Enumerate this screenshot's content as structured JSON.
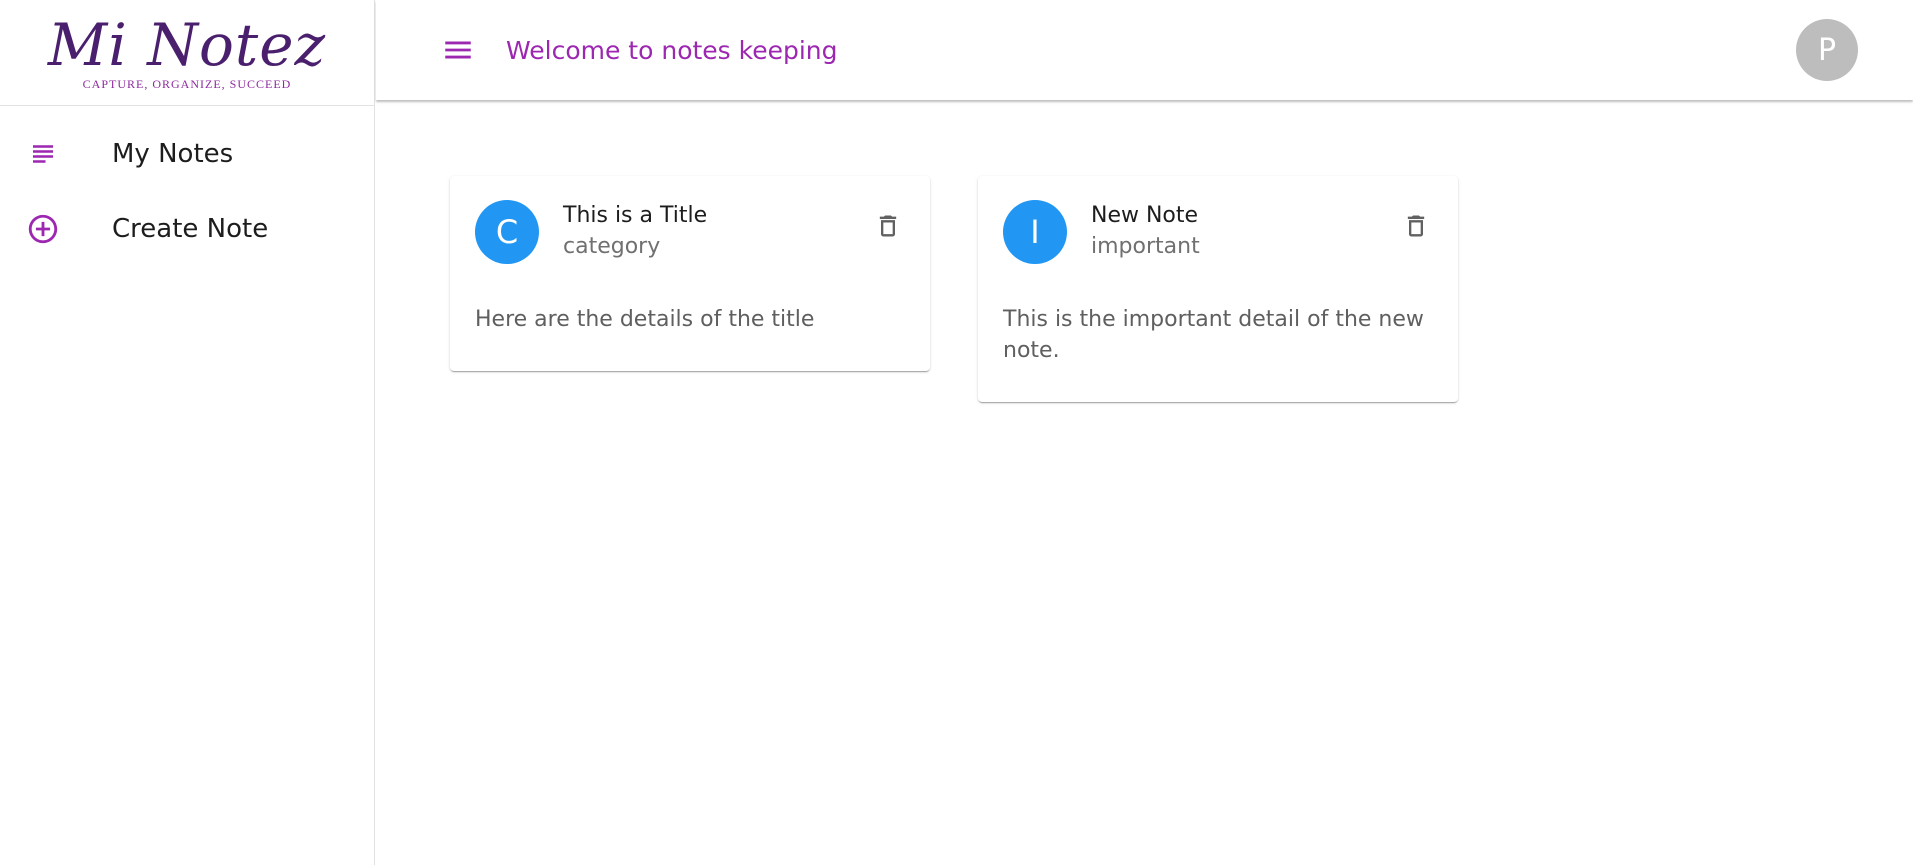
{
  "sidebar": {
    "logo": {
      "script_text": "Mi Notez",
      "tagline": "CAPTURE, ORGANIZE, SUCCEED"
    },
    "items": [
      {
        "label": "My Notes",
        "icon": "subject-icon"
      },
      {
        "label": "Create Note",
        "icon": "add-circle-icon"
      }
    ]
  },
  "header": {
    "menu_icon": "menu-icon",
    "title": "Welcome to notes keeping",
    "avatar_initial": "P"
  },
  "notes": [
    {
      "avatar_letter": "C",
      "title": "This is a Title",
      "category": "category",
      "details": "Here are the details of the title"
    },
    {
      "avatar_letter": "I",
      "title": "New Note",
      "category": "important",
      "details": "This is the important detail of the new note."
    }
  ],
  "colors": {
    "accent": "#9c27b0",
    "card_avatar": "#2196f3",
    "user_avatar": "#bdbdbd",
    "logo": "#4a1f6e"
  }
}
